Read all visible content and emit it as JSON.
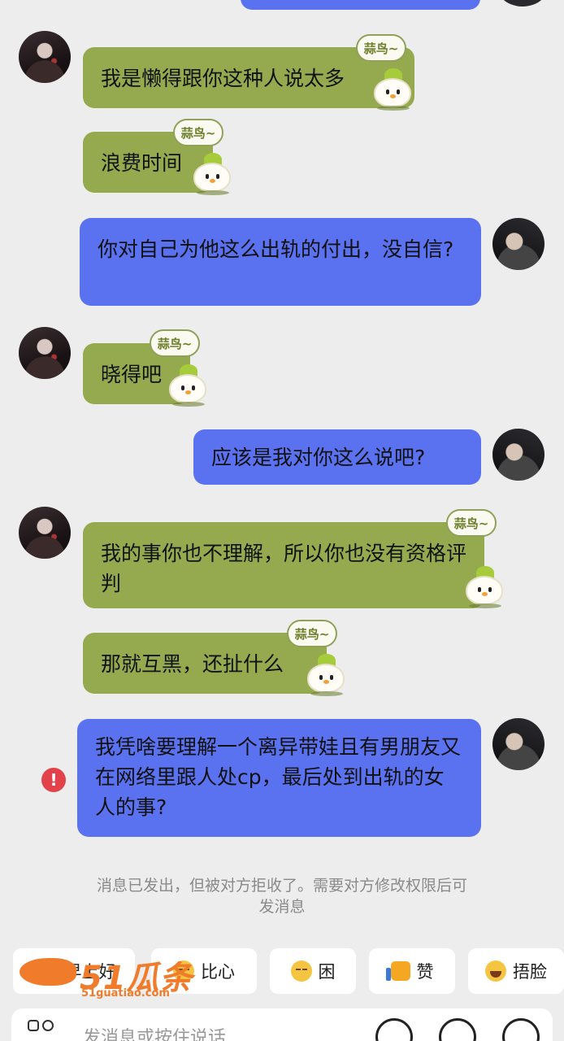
{
  "badge_text": "蒜鸟~",
  "messages": [
    {
      "side": "left",
      "text": "我是懒得跟你这种人说太多"
    },
    {
      "side": "left",
      "text": "浪费时间"
    },
    {
      "side": "right",
      "text": "你对自己为他这么出轨的付出，没自信?"
    },
    {
      "side": "left",
      "text": "晓得吧"
    },
    {
      "side": "right",
      "text": "应该是我对你这么说吧?"
    },
    {
      "side": "left",
      "text": "我的事你也不理解，所以你也没有资格评判"
    },
    {
      "side": "left",
      "text": "那就互黑，还扯什么"
    },
    {
      "side": "right",
      "text": "我凭啥要理解一个离异带娃且有男朋友又在网络里跟人处cp，最后处到出轨的女人的事?",
      "failed": true
    }
  ],
  "error_icon_text": "!",
  "notice": "消息已发出，但被对方拒收了。需要对方修改权限后可发消息",
  "quick_replies": [
    "早上好",
    "比心",
    "困",
    "赞",
    "捂脸"
  ],
  "watermark": {
    "main": "51瓜条",
    "sub": "51guatiao.com"
  },
  "input": {
    "placeholder": "发消息或按住说话"
  },
  "colors": {
    "background": "#ededed",
    "her_bubble": "#95aa4e",
    "my_bubble": "#5b72f0",
    "error": "#e2424a"
  },
  "icons": [
    "apps-icon",
    "voice-icon",
    "emoji-icon",
    "add-icon"
  ]
}
